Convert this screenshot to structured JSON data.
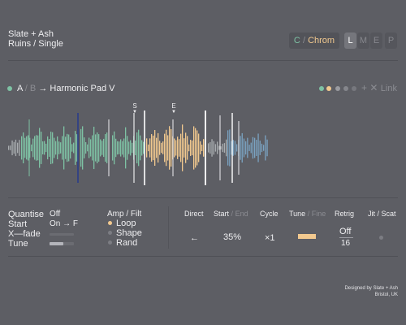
{
  "header": {
    "title": "Slate + Ash",
    "subtitle": "Ruins / Single"
  },
  "toolbar": {
    "scale_left": "C",
    "scale_sep": "/",
    "scale_right": "Chrom",
    "modes": [
      "L",
      "M",
      "E",
      "P"
    ],
    "active_mode": "L"
  },
  "slot": {
    "a": "A",
    "sep": "/",
    "b": "B",
    "arrow": "→",
    "preset": "Harmonic Pad V",
    "link_plus": "+",
    "link_x": "✕",
    "link_label": "Link"
  },
  "markers": {
    "start": "S",
    "end": "E"
  },
  "left_params": {
    "quantise_label": "Quantise",
    "quantise_value": "Off",
    "start_label": "Start",
    "start_value": "On → F",
    "xfade_label": "X—fade",
    "tune_label": "Tune",
    "tune_level": 0.55
  },
  "mod": {
    "amp": "Amp",
    "sep": "/",
    "filt": "Filt",
    "items": [
      "Loop",
      "Shape",
      "Rand"
    ],
    "active": "Loop"
  },
  "columns": {
    "direct": "Direct",
    "start": "Start",
    "start_sep": "/",
    "end": "End",
    "cycle": "Cycle",
    "tune": "Tune",
    "tune_sep": "/",
    "fine": "Fine",
    "retrig": "Retrig",
    "jit": "Jit",
    "jit_sep": "/",
    "scat": "Scat"
  },
  "values": {
    "direct": "←",
    "start": "35%",
    "cycle": "×1",
    "retrig_on": "Off",
    "retrig_sub": "16"
  },
  "credit": {
    "line1": "Designed by Slate + Ash",
    "line2": "Bristol, UK"
  },
  "colors": {
    "background": "#5d5e64",
    "green": "#7ec2a4",
    "orange": "#f2c98f",
    "blue": "#7aa3c2",
    "navy": "#2a3d8a"
  }
}
